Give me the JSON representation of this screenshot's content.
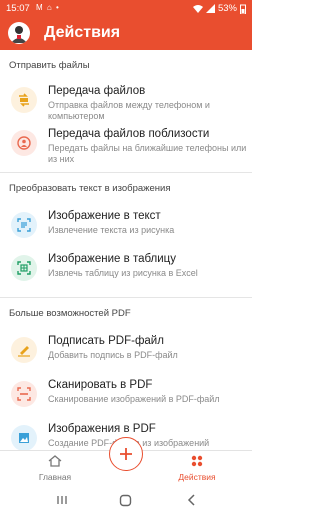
{
  "status": {
    "time": "15:07",
    "left_icons": "M ⌂ •",
    "battery": "53%"
  },
  "app": {
    "title": "Действия"
  },
  "sections": {
    "send": "Отправить файлы",
    "convert": "Преобразовать текст в изображения",
    "pdf": "Больше возможностей PDF"
  },
  "items": [
    {
      "title": "Передача файлов",
      "subtitle": "Отправка файлов между телефоном и компьютером",
      "icon": "file-transfer-icon",
      "color": "#e8a21b",
      "bg": "#fdf1de"
    },
    {
      "title": "Передача файлов поблизости",
      "subtitle": "Передать файлы на ближайшие телефоны или из них",
      "icon": "nearby-share-icon",
      "color": "#e9694f",
      "bg": "#fde8e3"
    },
    {
      "title": "Изображение в текст",
      "subtitle": "Извлечение текста из рисунка",
      "icon": "image-to-text-icon",
      "color": "#3aa0d8",
      "bg": "#e3f2fb"
    },
    {
      "title": "Изображение в таблицу",
      "subtitle": "Извлечь таблицу из рисунка в Excel",
      "icon": "image-to-table-icon",
      "color": "#1f9e64",
      "bg": "#e1f4ea"
    },
    {
      "title": "Подписать PDF-файл",
      "subtitle": "Добавить подпись в PDF-файл",
      "icon": "sign-pdf-icon",
      "color": "#e8a21b",
      "bg": "#fdf1de"
    },
    {
      "title": "Сканировать в PDF",
      "subtitle": "Сканирование изображений в PDF-файл",
      "icon": "scan-pdf-icon",
      "color": "#e9694f",
      "bg": "#fde8e3"
    },
    {
      "title": "Изображения в PDF",
      "subtitle": "Создание PDF-файла из изображений",
      "icon": "images-to-pdf-icon",
      "color": "#3aa0d8",
      "bg": "#e3f2fb"
    }
  ],
  "nav": {
    "home": "Главная",
    "actions": "Действия",
    "active_color": "#e94e2f"
  }
}
